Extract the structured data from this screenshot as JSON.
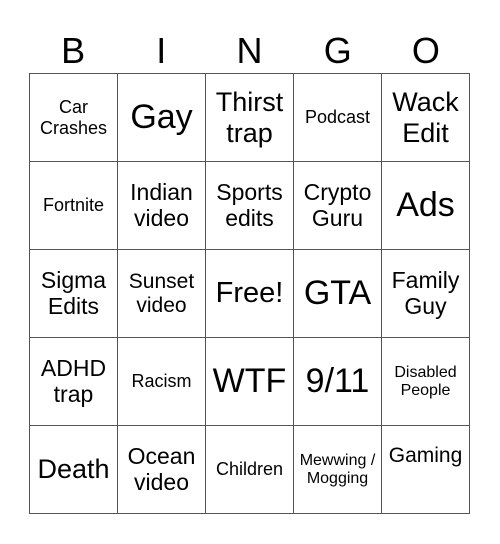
{
  "card": {
    "header_letters": [
      "B",
      "I",
      "N",
      "G",
      "O"
    ],
    "rows": [
      [
        "Car Crashes",
        "Gay",
        "Thirst trap",
        "Podcast",
        "Wack Edit"
      ],
      [
        "Fortnite",
        "Indian video",
        "Sports edits",
        "Crypto Guru",
        "Ads"
      ],
      [
        "Sigma Edits",
        "Sunset video",
        "Free!",
        "GTA",
        "Family Guy"
      ],
      [
        "ADHD trap",
        "Racism",
        "WTF",
        "9/11",
        "Disabled People"
      ],
      [
        "Death",
        "Ocean video",
        "Children",
        "Mewwing / Mogging",
        "Gaming"
      ]
    ],
    "free_space": "Free!",
    "colors": {
      "text": "#000000",
      "grid_line": "#555555",
      "background": "#ffffff"
    }
  }
}
